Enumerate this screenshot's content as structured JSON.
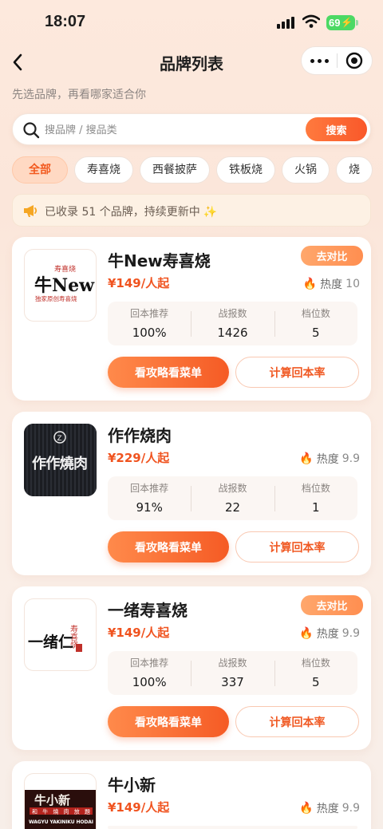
{
  "status_bar": {
    "time": "18:07",
    "battery": "69"
  },
  "nav": {
    "title": "品牌列表"
  },
  "subtitle": "先选品牌，再看哪家适合你",
  "search": {
    "placeholder": "搜品牌 / 搜品类",
    "button": "搜索"
  },
  "categories": [
    "全部",
    "寿喜烧",
    "西餐披萨",
    "铁板烧",
    "火锅",
    "烧"
  ],
  "active_category": "全部",
  "notice": {
    "text": "已收录 51 个品牌，持续更新中",
    "icon": "megaphone-icon"
  },
  "labels": {
    "recommend": "回本推荐",
    "reports": "战报数",
    "tiers": "档位数",
    "heat": "热度",
    "guide_button": "看攻略看菜单",
    "calc_button": "计算回本率",
    "compare_button": "去对比"
  },
  "brands": [
    {
      "name": "牛New寿喜烧",
      "price": "¥149/人起",
      "heat": "10",
      "recommend": "100%",
      "reports": "1426",
      "tiers": "5",
      "compare": true,
      "logo_main": "牛New",
      "logo_top": "寿喜烧",
      "logo_sub": "独家原创寿喜烧"
    },
    {
      "name": "作作烧肉",
      "price": "¥229/人起",
      "heat": "9.9",
      "recommend": "91%",
      "reports": "22",
      "tiers": "1",
      "compare": false,
      "logo_main": "作作燒肉",
      "logo_top": "Z"
    },
    {
      "name": "一绪寿喜烧",
      "price": "¥149/人起",
      "heat": "9.9",
      "recommend": "100%",
      "reports": "337",
      "tiers": "5",
      "compare": true,
      "logo_main": "一绪仁",
      "logo_top": "寿喜烧"
    },
    {
      "name": "牛小新",
      "price": "¥149/人起",
      "heat": "9.9",
      "compare": false,
      "logo_main": "牛小新",
      "logo_top": "和牛燒肉放題",
      "logo_sub": "WAGYU YAKINIKU HODAI"
    }
  ],
  "colors": {
    "accent": "#f55b25",
    "price": "#f0531f",
    "heat_icon": "#ff6a1f"
  }
}
